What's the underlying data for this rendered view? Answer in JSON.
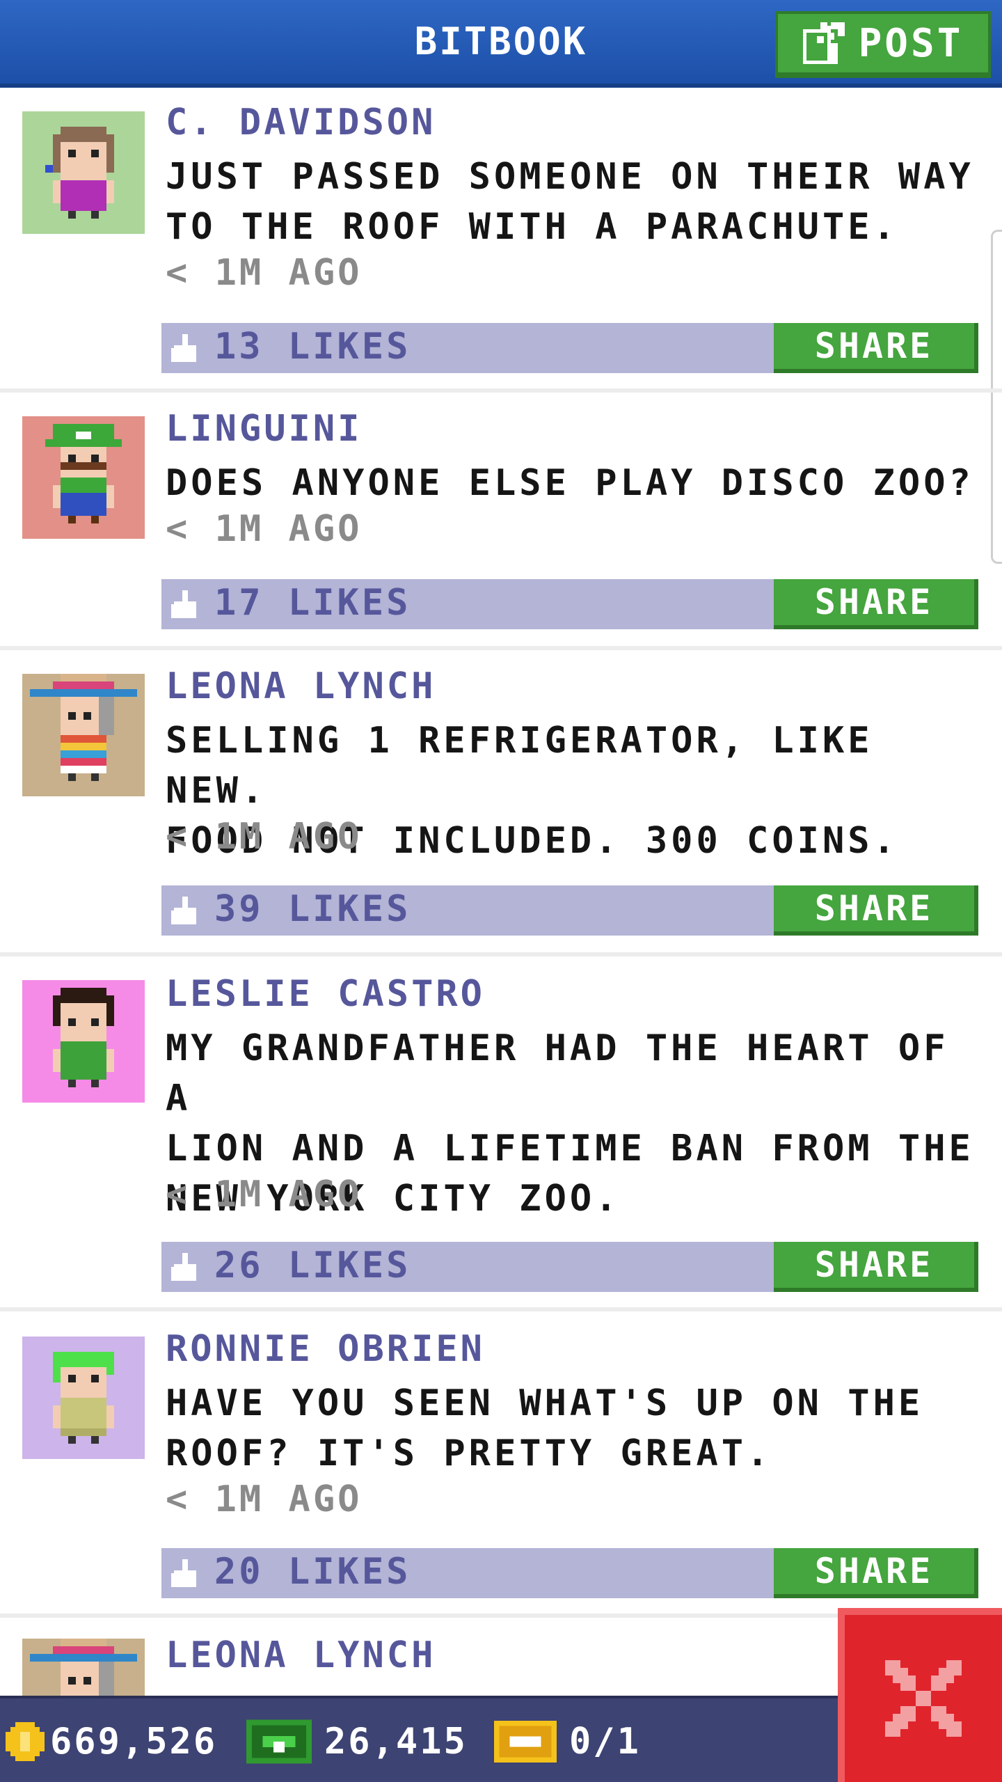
{
  "header": {
    "title": "BITBOOK",
    "post_label": "POST",
    "colors": {
      "header_blue": "#1d50a8",
      "button_green": "#45a53e"
    }
  },
  "posts": [
    {
      "author": "C. DAVIDSON",
      "text": "JUST PASSED SOMEONE ON THEIR WAY\nTO THE ROOF WITH A PARACHUTE.",
      "time": "< 1M AGO",
      "likes": "13 LIKES",
      "share": "SHARE",
      "avatar_bg": "#acd59a"
    },
    {
      "author": "LINGUINI",
      "text": "DOES ANYONE ELSE PLAY DISCO ZOO?",
      "time": "< 1M AGO",
      "likes": "17 LIKES",
      "share": "SHARE",
      "avatar_bg": "#e29088"
    },
    {
      "author": "LEONA LYNCH",
      "text": "SELLING 1 REFRIGERATOR, LIKE NEW.\nFOOD NOT INCLUDED. 300 COINS.",
      "time": "< 1M AGO",
      "likes": "39 LIKES",
      "share": "SHARE",
      "avatar_bg": "#c7b08b"
    },
    {
      "author": "LESLIE CASTRO",
      "text": "MY GRANDFATHER HAD THE HEART OF A\nLION AND A LIFETIME BAN FROM THE\nNEW YORK CITY ZOO.",
      "time": "< 1M AGO",
      "likes": "26 LIKES",
      "share": "SHARE",
      "avatar_bg": "#f58be6"
    },
    {
      "author": "RONNIE OBRIEN",
      "text": "HAVE YOU SEEN WHAT'S UP ON THE\nROOF? IT'S PRETTY GREAT.",
      "time": "< 1M AGO",
      "likes": "20 LIKES",
      "share": "SHARE",
      "avatar_bg": "#cdb4ea"
    },
    {
      "author": "LEONA LYNCH",
      "avatar_bg": "#c7b08b"
    }
  ],
  "bottom_bar": {
    "coins": "669,526",
    "bux": "26,415",
    "tickets": "0/1"
  },
  "close_icon": "close-x-icon"
}
